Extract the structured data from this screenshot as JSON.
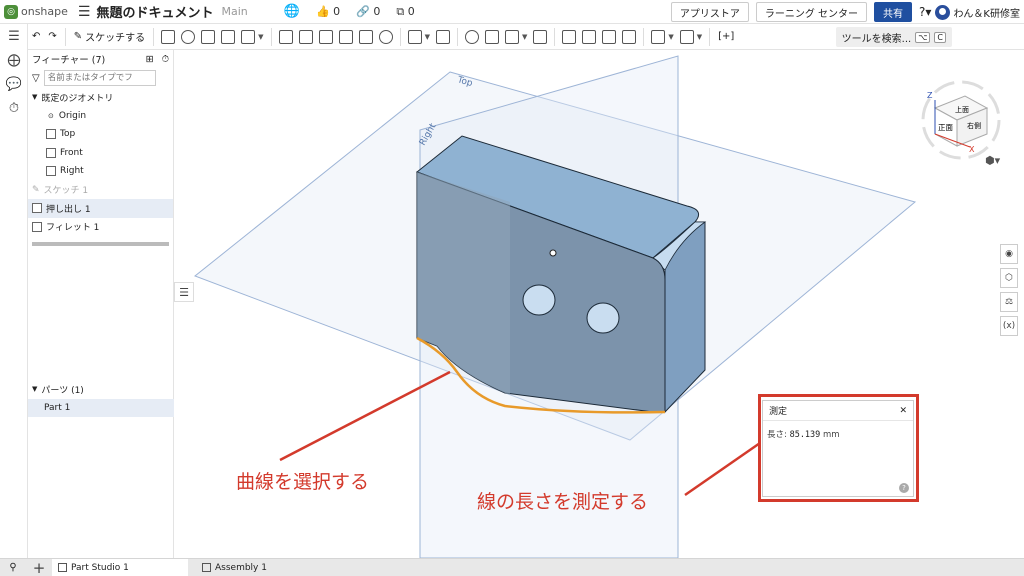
{
  "header": {
    "logo_text": "onshape",
    "doc_title": "無題のドキュメント",
    "branch": "Main",
    "likes": "0",
    "links": "0",
    "copies": "0",
    "app_store": "アプリストア",
    "learning": "ラーニング センター",
    "share": "共有",
    "user": "わん＆K研修室"
  },
  "toolbar": {
    "sketch_label": "スケッチする",
    "search_label": "ツールを検索...",
    "shortcut_1": "⌥",
    "shortcut_2": "C"
  },
  "panel": {
    "features_title": "フィーチャー (7)",
    "filter_placeholder": "名前またはタイプでフ",
    "default_geometry": "既定のジオメトリ",
    "items": [
      "Origin",
      "Top",
      "Front",
      "Right"
    ],
    "sketch": "スケッチ 1",
    "extrude": "押し出し 1",
    "fillet": "フィレット 1",
    "parts_title": "パーツ (1)",
    "part": "Part 1"
  },
  "viewport": {
    "plane_top": "Top",
    "plane_right": "Right",
    "cube_top": "上面",
    "cube_front": "正面",
    "cube_right": "右側",
    "axis_z": "Z",
    "axis_x": "X"
  },
  "measure": {
    "title": "測定",
    "label": "長さ:",
    "value": "85.139",
    "unit": "mm"
  },
  "annotations": {
    "select_curve": "曲線を選択する",
    "measure_line": "線の長さを測定する"
  },
  "tabs": [
    "Part Studio 1",
    "Assembly 1"
  ],
  "colors": {
    "accent": "#1f4fa0",
    "annotation": "#d33a2c",
    "part": "#7f99b0",
    "edge_highlight": "#e89a2a"
  }
}
